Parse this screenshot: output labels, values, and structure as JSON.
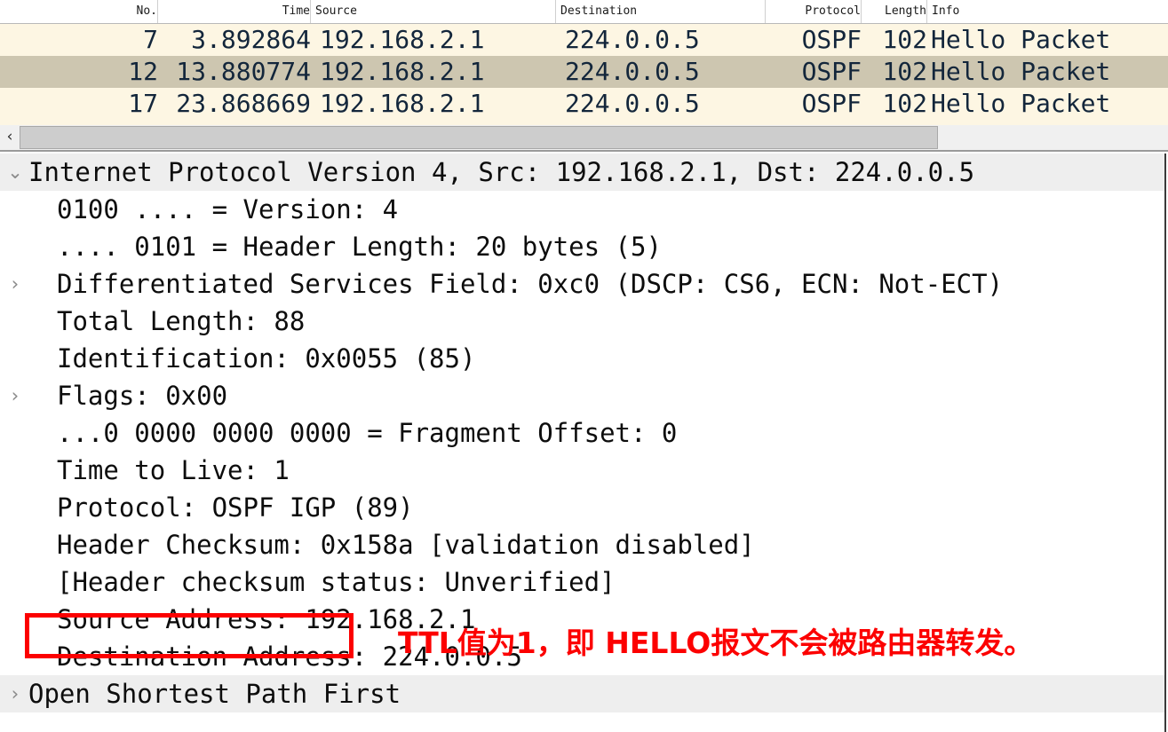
{
  "packet_list": {
    "columns": [
      {
        "key": "no",
        "label": "No."
      },
      {
        "key": "time",
        "label": "Time"
      },
      {
        "key": "source",
        "label": "Source"
      },
      {
        "key": "dest",
        "label": "Destination"
      },
      {
        "key": "protocol",
        "label": "Protocol"
      },
      {
        "key": "length",
        "label": "Length"
      },
      {
        "key": "info",
        "label": "Info"
      }
    ],
    "rows": [
      {
        "no": "7",
        "time": "3.892864",
        "source": "192.168.2.1",
        "dest": "224.0.0.5",
        "protocol": "OSPF",
        "length": "102",
        "info": "Hello Packet",
        "selected": false
      },
      {
        "no": "12",
        "time": "13.880774",
        "source": "192.168.2.1",
        "dest": "224.0.0.5",
        "protocol": "OSPF",
        "length": "102",
        "info": "Hello Packet",
        "selected": true
      },
      {
        "no": "17",
        "time": "23.868669",
        "source": "192.168.2.1",
        "dest": "224.0.0.5",
        "protocol": "OSPF",
        "length": "102",
        "info": "Hello Packet",
        "selected": false
      }
    ]
  },
  "scrollbar": {
    "left_arrow": "‹"
  },
  "detail_tree": {
    "rows": [
      {
        "twisty": "⌄",
        "indent": 0,
        "highlight": true,
        "text": "Internet Protocol Version 4, Src: 192.168.2.1, Dst: 224.0.0.5"
      },
      {
        "twisty": "",
        "indent": 1,
        "highlight": false,
        "text": "0100 .... = Version: 4"
      },
      {
        "twisty": "",
        "indent": 1,
        "highlight": false,
        "text": ".... 0101 = Header Length: 20 bytes (5)"
      },
      {
        "twisty": "›",
        "indent": 1,
        "highlight": false,
        "text": "Differentiated Services Field: 0xc0 (DSCP: CS6, ECN: Not-ECT)"
      },
      {
        "twisty": "",
        "indent": 1,
        "highlight": false,
        "text": "Total Length: 88"
      },
      {
        "twisty": "",
        "indent": 1,
        "highlight": false,
        "text": "Identification: 0x0055 (85)"
      },
      {
        "twisty": "›",
        "indent": 1,
        "highlight": false,
        "text": "Flags: 0x00"
      },
      {
        "twisty": "",
        "indent": 1,
        "highlight": false,
        "text": "...0 0000 0000 0000 = Fragment Offset: 0"
      },
      {
        "twisty": "",
        "indent": 1,
        "highlight": false,
        "text": "Time to Live: 1"
      },
      {
        "twisty": "",
        "indent": 1,
        "highlight": false,
        "text": "Protocol: OSPF IGP (89)"
      },
      {
        "twisty": "",
        "indent": 1,
        "highlight": false,
        "text": "Header Checksum: 0x158a [validation disabled]"
      },
      {
        "twisty": "",
        "indent": 1,
        "highlight": false,
        "text": "[Header checksum status: Unverified]"
      },
      {
        "twisty": "",
        "indent": 1,
        "highlight": false,
        "text": "Source Address: 192.168.2.1"
      },
      {
        "twisty": "",
        "indent": 1,
        "highlight": false,
        "text": "Destination Address: 224.0.0.5"
      },
      {
        "twisty": "›",
        "indent": 0,
        "highlight": true,
        "text": "Open Shortest Path First"
      }
    ]
  },
  "annotation": {
    "text": "TTL值为1，即 HELLO报文不会被路由器转发。",
    "color": "#fc0000",
    "highlight_box_color": "#fc0000",
    "highlight_target": "Time to Live: 1"
  },
  "colors": {
    "packet_row_bg": "#fdf6e3",
    "packet_row_selected_bg": "#cdc6b0",
    "tree_highlight_bg": "#eeeeee",
    "annotation_red": "#fc0000",
    "scrollbar_thumb": "#cdcdcd"
  }
}
